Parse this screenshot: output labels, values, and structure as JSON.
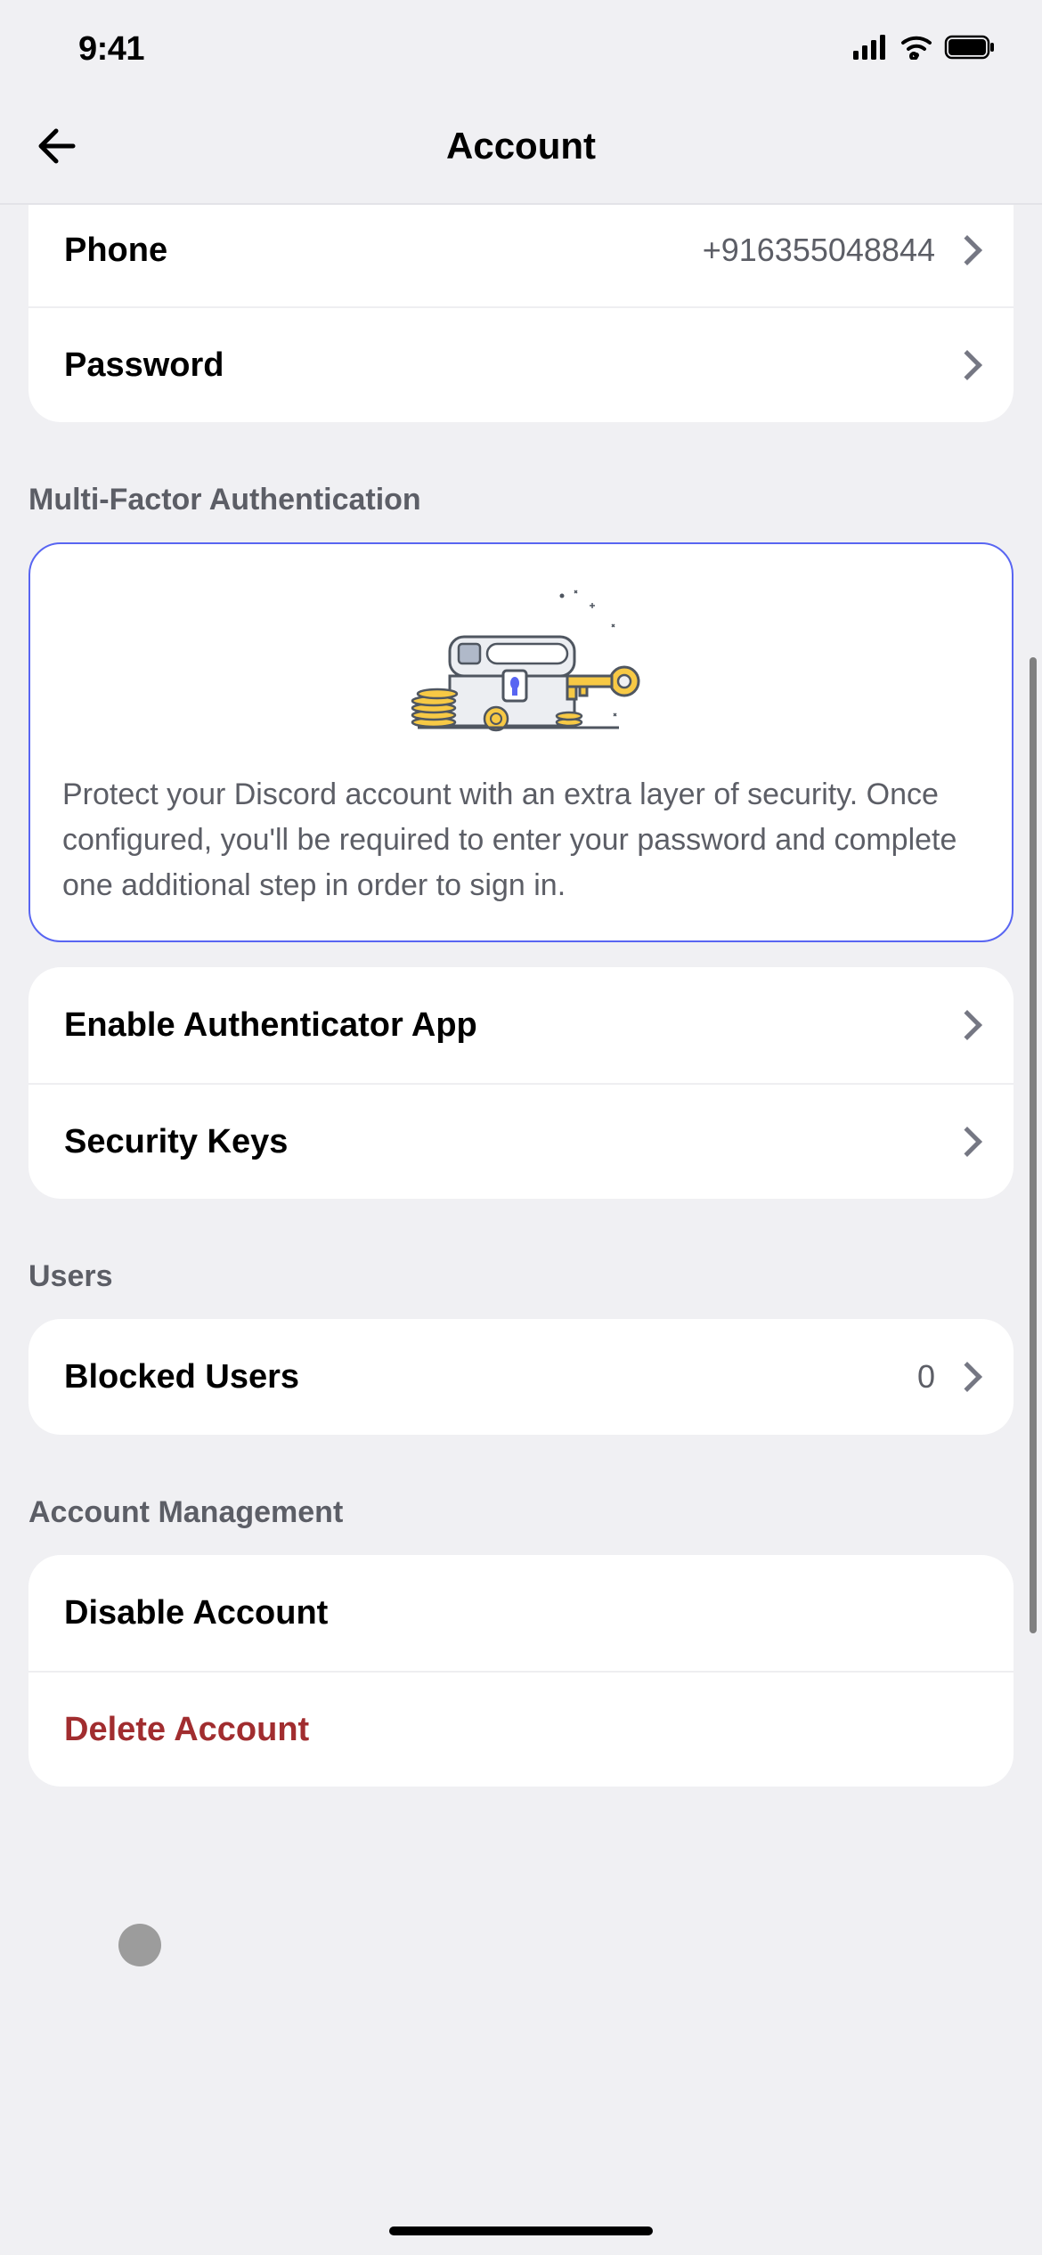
{
  "status": {
    "time": "9:41"
  },
  "header": {
    "title": "Account"
  },
  "sections": {
    "phone": {
      "label": "Phone",
      "value": "+916355048844"
    },
    "password": {
      "label": "Password"
    },
    "mfa": {
      "header": "Multi-Factor Authentication",
      "description": "Protect your Discord account with an extra layer of security. Once configured, you'll be required to enter your password and complete one additional step in order to sign in.",
      "enable_auth": {
        "label": "Enable Authenticator App"
      },
      "security_keys": {
        "label": "Security Keys"
      }
    },
    "users": {
      "header": "Users",
      "blocked": {
        "label": "Blocked Users",
        "count": "0"
      }
    },
    "management": {
      "header": "Account Management",
      "disable": {
        "label": "Disable Account"
      },
      "delete": {
        "label": "Delete Account"
      }
    }
  }
}
